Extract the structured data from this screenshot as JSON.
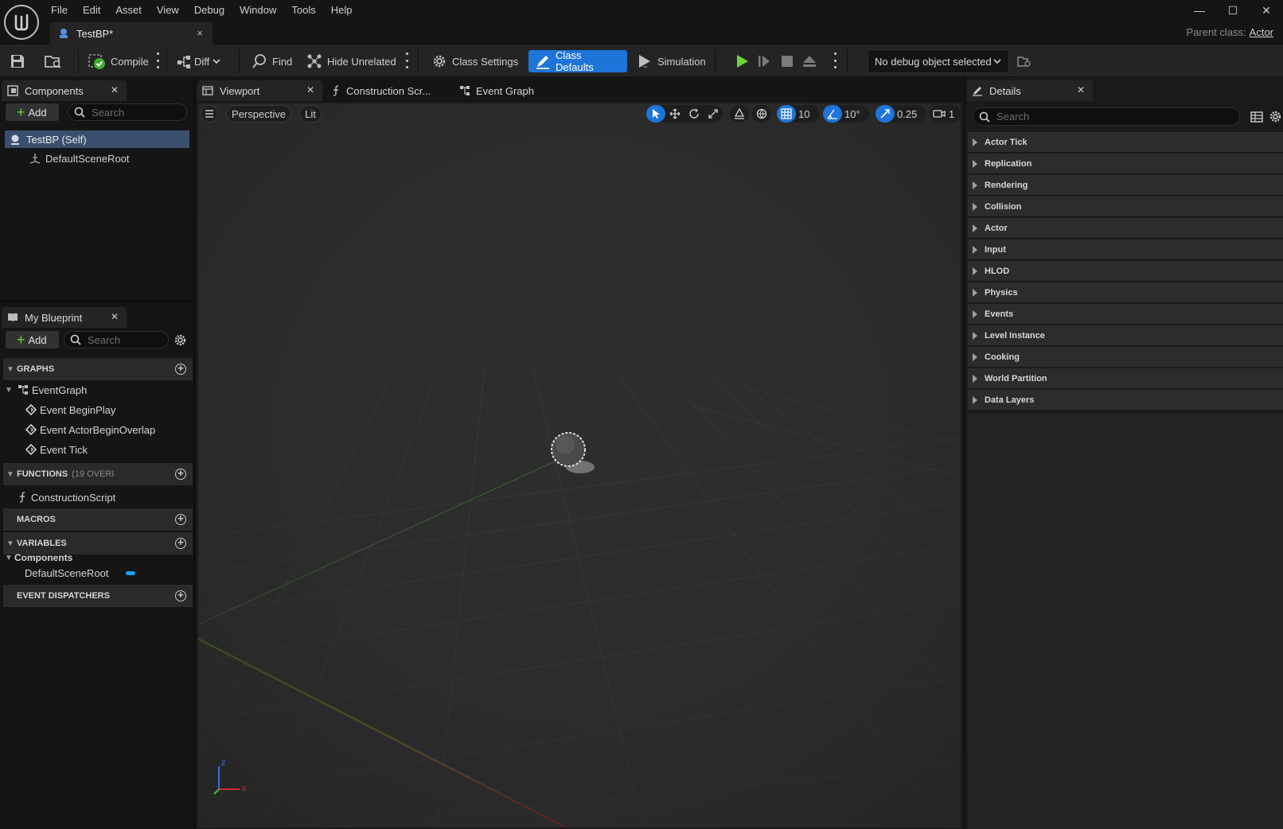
{
  "menu": [
    "File",
    "Edit",
    "Asset",
    "View",
    "Debug",
    "Window",
    "Tools",
    "Help"
  ],
  "document_tab": {
    "label": "TestBP*",
    "close": "×"
  },
  "window_controls": {
    "minimize": "—",
    "maximize": "☐",
    "close": "✕"
  },
  "parent_class": {
    "label": "Parent class:",
    "value": "Actor"
  },
  "toolbar": {
    "compile": "Compile",
    "diff": "Diff",
    "find": "Find",
    "hide_unrelated": "Hide Unrelated",
    "class_settings": "Class Settings",
    "class_defaults": "Class Defaults",
    "simulation": "Simulation",
    "debug_object": "No debug object selected"
  },
  "components_panel": {
    "title": "Components",
    "add": "Add",
    "search_placeholder": "Search",
    "items": [
      "TestBP (Self)",
      "DefaultSceneRoot"
    ]
  },
  "my_blueprint": {
    "title": "My Blueprint",
    "add": "Add",
    "search_placeholder": "Search",
    "graphs_header": "GRAPHS",
    "event_graph": "EventGraph",
    "events": [
      "Event BeginPlay",
      "Event ActorBeginOverlap",
      "Event Tick"
    ],
    "functions_header": "FUNCTIONS",
    "functions_note": "(19 OVERI",
    "construction_script": "ConstructionScript",
    "macros_header": "MACROS",
    "variables_header": "VARIABLES",
    "variables_category": "Components",
    "variable_item": "DefaultSceneRoot",
    "dispatchers_header": "EVENT DISPATCHERS"
  },
  "editor_tabs": [
    "Viewport",
    "Construction Scr...",
    "Event Graph"
  ],
  "viewport": {
    "view_mode": "Perspective",
    "lighting": "Lit",
    "grid_snap": "10",
    "rotation_snap": "10°",
    "scale_snap": "0.25",
    "camera_speed": "1",
    "axis_labels": {
      "x": "x",
      "z": "z"
    }
  },
  "details_panel": {
    "title": "Details",
    "search_placeholder": "Search",
    "categories": [
      "Actor Tick",
      "Replication",
      "Rendering",
      "Collision",
      "Actor",
      "Input",
      "HLOD",
      "Physics",
      "Events",
      "Level Instance",
      "Cooking",
      "World Partition",
      "Data Layers"
    ]
  },
  "colors": {
    "accent": "#1e74d8",
    "panel_bg": "#151515",
    "viewport_bg": "#2d2d2d",
    "play_green": "#6bd33a",
    "variable_pill": "#1aa0f0"
  }
}
